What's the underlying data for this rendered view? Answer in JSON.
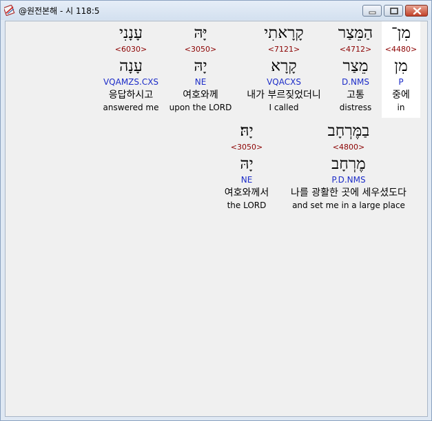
{
  "window": {
    "title": "@원전본해 - 시 118:5",
    "minimize_label": "Minimize",
    "maximize_label": "Maximize",
    "close_label": "Close"
  },
  "verse": {
    "rows": [
      {
        "words": [
          {
            "hebrew": "מִן־",
            "strong": "<4480>",
            "root": "מִן",
            "parse": "P",
            "korean": "중에",
            "english": "in",
            "selected": true
          },
          {
            "hebrew": "הַמֵּצַר",
            "strong": "<4712>",
            "root": "מֵצַר",
            "parse": "D.NMS",
            "korean": "고통",
            "english": "distress",
            "selected": false
          },
          {
            "hebrew": "קָרָאתִי",
            "strong": "<7121>",
            "root": "קָרָא",
            "parse": "VQACXS",
            "korean": "내가 부르짖었더니",
            "english": "I called",
            "selected": false
          },
          {
            "hebrew": "יָּהּ",
            "strong": "<3050>",
            "root": "יָהּ",
            "parse": "NE",
            "korean": "여호와께",
            "english": "upon the LORD",
            "selected": false
          },
          {
            "hebrew": "עָנָנִי",
            "strong": "<6030>",
            "root": "עָנָה",
            "parse": "VQAMZS.CXS",
            "korean": "응답하시고",
            "english": "answered me",
            "selected": false
          }
        ]
      },
      {
        "words": [
          {
            "hebrew": "בַמֶּרְחָב",
            "strong": "<4800>",
            "root": "מֶרְחָב",
            "parse": "P.D.NMS",
            "korean": "나를 광활한 곳에 세우셨도다",
            "english": "and set me in a large place",
            "selected": false
          },
          {
            "hebrew": "יָהּ׃",
            "strong": "<3050>",
            "root": "יָהּ",
            "parse": "NE",
            "korean": "여호와께서",
            "english": "the LORD",
            "selected": false
          }
        ]
      }
    ]
  }
}
